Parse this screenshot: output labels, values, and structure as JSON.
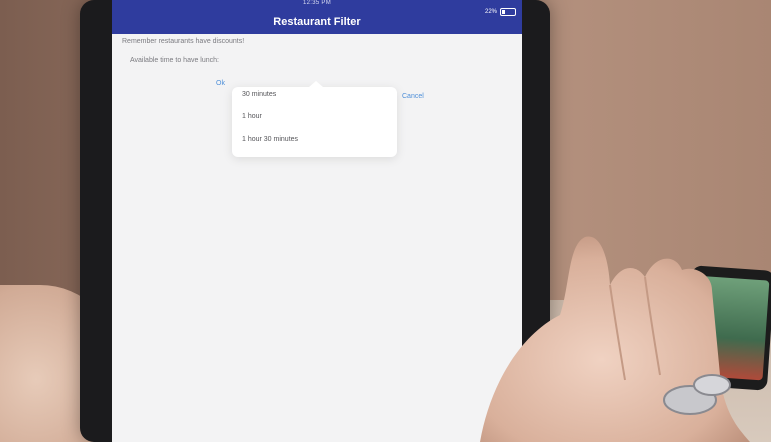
{
  "status_bar": {
    "time": "12:35 PM",
    "battery": "22%"
  },
  "navbar": {
    "title": "Restaurant Filter"
  },
  "rows": {
    "discounts": "Remember restaurants have discounts!",
    "lunch_time": "Available time to have lunch:"
  },
  "picker": {
    "ok_label": "Ok",
    "cancel_label": "Cancel",
    "options": [
      "30 minutes",
      "1 hour",
      "1 hour 30 minutes"
    ]
  },
  "colors": {
    "navbar": "#2f3c9e",
    "link": "#4e8fd9"
  }
}
